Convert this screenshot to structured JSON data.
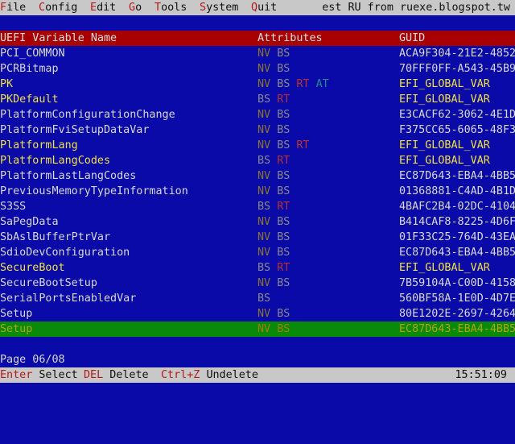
{
  "menu": {
    "items": [
      {
        "hot": "F",
        "rest": "ile"
      },
      {
        "hot": "C",
        "rest": "onfig"
      },
      {
        "hot": "E",
        "rest": "dit"
      },
      {
        "hot": "G",
        "rest": "o"
      },
      {
        "hot": "T",
        "rest": "ools"
      },
      {
        "hot": "S",
        "rest": "ystem"
      },
      {
        "hot": "Q",
        "rest": "uit"
      }
    ],
    "info": "est RU from ruexe.blogspot.tw"
  },
  "table": {
    "headers": {
      "name": "UEFI Variable Name",
      "attributes": "Attributes",
      "guid": "GUID"
    },
    "rows": [
      {
        "name": "PCI_COMMON",
        "attrs": [
          "NV",
          "BS"
        ],
        "guid": "ACA9F304-21E2-4852",
        "highlight": false
      },
      {
        "name": "PCRBitmap",
        "attrs": [
          "NV",
          "BS"
        ],
        "guid": "70FFF0FF-A543-45B9",
        "highlight": false
      },
      {
        "name": "PK",
        "attrs": [
          "NV",
          "BS",
          "RT",
          "AT"
        ],
        "guid": "EFI_GLOBAL_VAR",
        "highlight": true
      },
      {
        "name": "PKDefault",
        "attrs": [
          "BS",
          "RT"
        ],
        "guid": "EFI_GLOBAL_VAR",
        "highlight": true
      },
      {
        "name": "PlatformConfigurationChange",
        "attrs": [
          "NV",
          "BS"
        ],
        "guid": "E3CACF62-3062-4E1D",
        "highlight": false
      },
      {
        "name": "PlatformFviSetupDataVar",
        "attrs": [
          "NV",
          "BS"
        ],
        "guid": "F375CC65-6065-48F3",
        "highlight": false
      },
      {
        "name": "PlatformLang",
        "attrs": [
          "NV",
          "BS",
          "RT"
        ],
        "guid": "EFI_GLOBAL_VAR",
        "highlight": true
      },
      {
        "name": "PlatformLangCodes",
        "attrs": [
          "BS",
          "RT"
        ],
        "guid": "EFI_GLOBAL_VAR",
        "highlight": true
      },
      {
        "name": "PlatformLastLangCodes",
        "attrs": [
          "NV",
          "BS"
        ],
        "guid": "EC87D643-EBA4-4BB5",
        "highlight": false
      },
      {
        "name": "PreviousMemoryTypeInformation",
        "attrs": [
          "NV",
          "BS"
        ],
        "guid": "01368881-C4AD-4B1D",
        "highlight": false
      },
      {
        "name": "S3SS",
        "attrs": [
          "BS",
          "RT"
        ],
        "guid": "4BAFC2B4-02DC-4104",
        "highlight": false
      },
      {
        "name": "SaPegData",
        "attrs": [
          "NV",
          "BS"
        ],
        "guid": "B414CAF8-8225-4D6F",
        "highlight": false
      },
      {
        "name": "SbAslBufferPtrVar",
        "attrs": [
          "NV",
          "BS"
        ],
        "guid": "01F33C25-764D-43EA",
        "highlight": false
      },
      {
        "name": "SdioDevConfiguration",
        "attrs": [
          "NV",
          "BS"
        ],
        "guid": "EC87D643-EBA4-4BB5",
        "highlight": false
      },
      {
        "name": "SecureBoot",
        "attrs": [
          "BS",
          "RT"
        ],
        "guid": "EFI_GLOBAL_VAR",
        "highlight": true
      },
      {
        "name": "SecureBootSetup",
        "attrs": [
          "NV",
          "BS"
        ],
        "guid": "7B59104A-C00D-4158",
        "highlight": false
      },
      {
        "name": "SerialPortsEnabledVar",
        "attrs": [
          "BS"
        ],
        "guid": "560BF58A-1E0D-4D7E",
        "highlight": false
      },
      {
        "name": "Setup",
        "attrs": [
          "NV",
          "BS"
        ],
        "guid": "80E1202E-2697-4264",
        "highlight": false
      },
      {
        "name": "Setup",
        "attrs": [
          "NV",
          "BS"
        ],
        "guid": "EC87D643-EBA4-4BB5",
        "highlight": false,
        "selected": true
      }
    ]
  },
  "page_info": "Page 06/08",
  "status": {
    "items": [
      {
        "key": "Enter",
        "label": "Select"
      },
      {
        "key": "DEL",
        "label": "Delete"
      },
      {
        "key": "Ctrl+Z",
        "label": "Undelete"
      }
    ],
    "clock": "15:51:09"
  },
  "colors": {
    "background": "#0a0aa8",
    "header": "#a80000",
    "selection": "#0a8a0a",
    "bars": "#c8c8c8"
  }
}
